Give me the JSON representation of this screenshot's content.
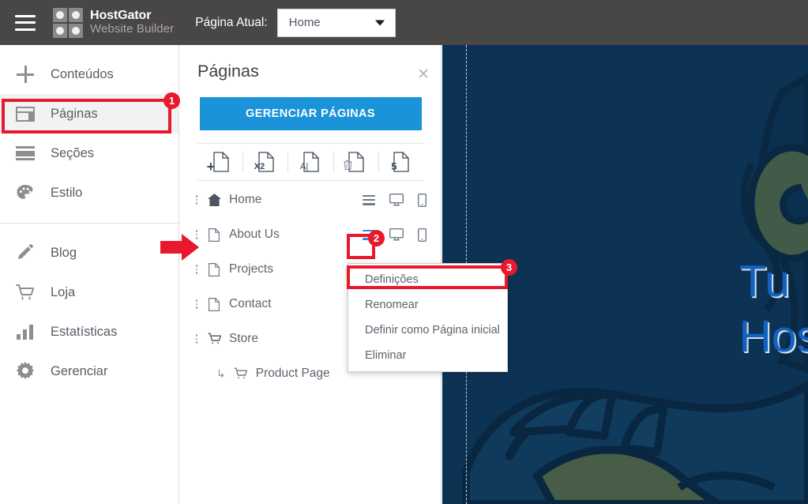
{
  "header": {
    "menu_icon": "hamburger-menu-icon",
    "logo": {
      "line1": "HostGator",
      "line2": "Website Builder"
    },
    "current_page_label": "Página Atual:",
    "page_select": {
      "value": "Home",
      "options": [
        "Home",
        "About Us",
        "Projects",
        "Contact",
        "Store",
        "Product Page"
      ]
    }
  },
  "sidebar": {
    "group1": [
      {
        "label": "Conteúdos",
        "icon": "plus-icon",
        "active": false
      },
      {
        "label": "Páginas",
        "icon": "pages-layout-icon",
        "active": true
      },
      {
        "label": "Seções",
        "icon": "sections-icon",
        "active": false
      },
      {
        "label": "Estilo",
        "icon": "palette-icon",
        "active": false
      }
    ],
    "group2": [
      {
        "label": "Blog",
        "icon": "pencil-icon",
        "active": false
      },
      {
        "label": "Loja",
        "icon": "shopping-cart-icon",
        "active": false
      },
      {
        "label": "Estatísticas",
        "icon": "bar-chart-icon",
        "active": false
      },
      {
        "label": "Gerenciar",
        "icon": "gear-icon",
        "active": false
      }
    ]
  },
  "panel": {
    "title": "Páginas",
    "close_icon": "close-icon",
    "manage_button": "GERENCIAR PÁGINAS",
    "toolbar": [
      {
        "name": "add-page",
        "symbol": "+",
        "icon": "document-plus-icon"
      },
      {
        "name": "duplicate-page",
        "symbol": "X2",
        "icon": "document-duplicate-icon"
      },
      {
        "name": "rename-page",
        "symbol": "A|",
        "icon": "document-rename-icon"
      },
      {
        "name": "delete-page",
        "symbol": "trash",
        "icon": "document-trash-icon"
      },
      {
        "name": "page-count",
        "symbol": "5",
        "icon": "document-number-icon"
      }
    ],
    "pages": [
      {
        "name": "Home",
        "icon": "home-icon",
        "sub": false,
        "menu_active": false
      },
      {
        "name": "About Us",
        "icon": "document-icon",
        "sub": false,
        "menu_active": true
      },
      {
        "name": "Projects",
        "icon": "document-icon",
        "sub": false,
        "menu_active": false
      },
      {
        "name": "Contact",
        "icon": "document-icon",
        "sub": false,
        "menu_active": false
      },
      {
        "name": "Store",
        "icon": "cart-icon",
        "sub": false,
        "menu_active": false
      },
      {
        "name": "Product Page",
        "icon": "cart-icon",
        "sub": true,
        "menu_active": false
      }
    ],
    "row_action_icons": [
      "menu-icon",
      "desktop-icon",
      "mobile-icon"
    ]
  },
  "dropdown": {
    "items": [
      {
        "label": "Definições",
        "highlighted": true
      },
      {
        "label": "Renomear",
        "highlighted": false
      },
      {
        "label": "Definir como Página inicial",
        "highlighted": false
      },
      {
        "label": "Eliminar",
        "highlighted": false
      }
    ]
  },
  "preview": {
    "hero_line1": "Tu",
    "hero_line2": "Hos",
    "background_color": "#0d3354",
    "hero_text_color": "#1063c4"
  },
  "annotations": {
    "accent_color": "#e8192c",
    "badges": [
      {
        "number": "1",
        "target": "sidebar-item-paginas"
      },
      {
        "number": "2",
        "target": "about-us-menu-icon"
      },
      {
        "number": "3",
        "target": "dropdown-item-definicoes"
      }
    ],
    "arrow": {
      "direction": "right",
      "target": "about-us-row"
    }
  }
}
